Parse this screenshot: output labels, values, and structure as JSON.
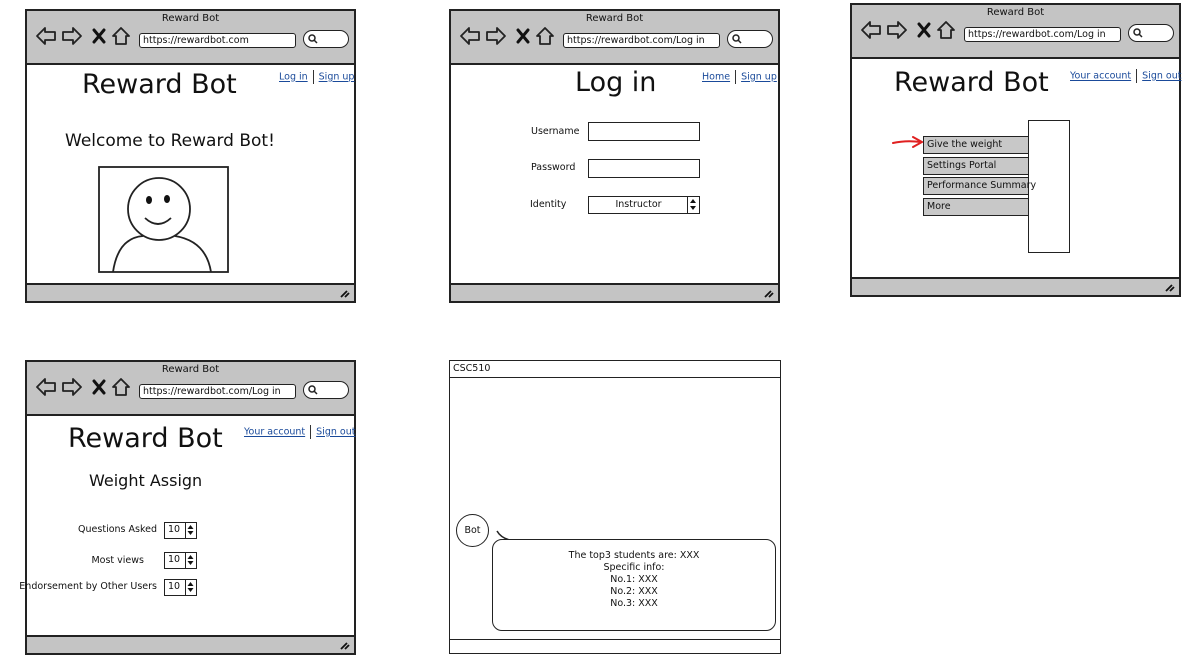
{
  "windows": {
    "home": {
      "title": "Reward Bot",
      "url": "https://rewardbot.com",
      "brand": "Reward Bot",
      "links": [
        "Log in",
        "Sign up"
      ],
      "welcome": "Welcome to Reward Bot!"
    },
    "login": {
      "title": "Reward Bot",
      "url": "https://rewardbot.com/Log in",
      "heading": "Log in",
      "links": [
        "Home",
        "Sign up"
      ],
      "fields": {
        "username": "Username",
        "password": "Password",
        "identity": "Identity"
      },
      "identity_value": "Instructor"
    },
    "dashboard": {
      "title": "Reward Bot",
      "url": "https://rewardbot.com/Log in",
      "brand": "Reward Bot",
      "links": [
        "Your account",
        "Sign out"
      ],
      "menu": [
        "Give the weight",
        "Settings Portal",
        "Performance Summary",
        "More"
      ],
      "arrow_color": "#e02020"
    },
    "weights": {
      "title": "Reward Bot",
      "url": "https://rewardbot.com/Log in",
      "brand": "Reward Bot",
      "links": [
        "Your account",
        "Sign out"
      ],
      "heading": "Weight Assign",
      "rows": [
        {
          "label": "Questions Asked",
          "value": "10"
        },
        {
          "label": "Most views",
          "value": "10"
        },
        {
          "label": "Endorsement by Other Users",
          "value": "10"
        }
      ]
    },
    "chat": {
      "title": "CSC510",
      "bot_label": "Bot",
      "message_lines": [
        "The top3 students are: XXX",
        "Specific info:",
        "No.1: XXX",
        "No.2: XXX",
        "No.3: XXX"
      ]
    }
  },
  "icons": [
    "back-icon",
    "forward-icon",
    "close-icon",
    "home-icon",
    "search-icon",
    "resize-grip-icon",
    "user-avatar-icon",
    "spinner-arrows-icon",
    "pointer-arrow-icon"
  ]
}
